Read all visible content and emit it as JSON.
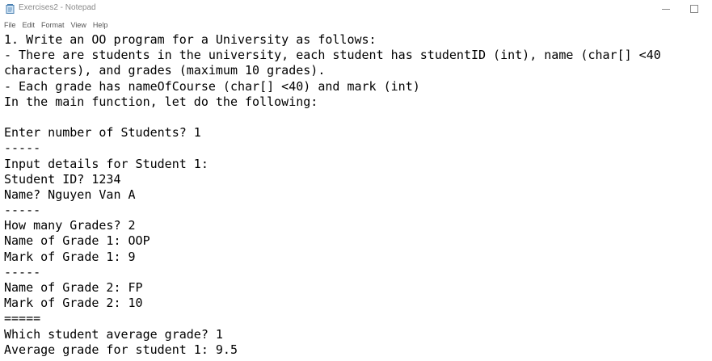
{
  "window": {
    "title": "Exercises2 - Notepad",
    "icon": "notepad-icon",
    "controls": [
      "minimize-icon",
      "maximize-icon"
    ]
  },
  "menu": {
    "items": [
      {
        "label": "File"
      },
      {
        "label": "Edit"
      },
      {
        "label": "Format"
      },
      {
        "label": "View"
      },
      {
        "label": "Help"
      }
    ]
  },
  "editor": {
    "lines": [
      "1. Write an OO program for a University as follows:",
      "- There are students in the university, each student has studentID (int), name (char[] <40",
      "characters), and grades (maximum 10 grades).",
      "- Each grade has nameOfCourse (char[] <40) and mark (int)",
      "In the main function, let do the following:",
      "",
      "Enter number of Students? 1",
      "-----",
      "Input details for Student 1:",
      "Student ID? 1234",
      "Name? Nguyen Van A",
      "-----",
      "How many Grades? 2",
      "Name of Grade 1: OOP",
      "Mark of Grade 1: 9",
      "-----",
      "Name of Grade 2: FP",
      "Mark of Grade 2: 10",
      "=====",
      "Which student average grade? 1",
      "Average grade for student 1: 9.5"
    ]
  },
  "colors": {
    "title_text": "#8a8a8a",
    "menu_text": "#555555",
    "editor_text": "#000000",
    "background": "#ffffff"
  }
}
